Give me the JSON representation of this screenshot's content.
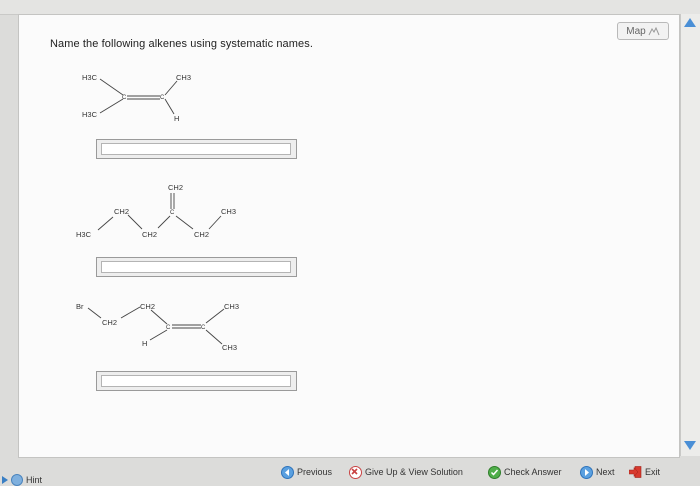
{
  "question": {
    "text": "Name the following alkenes using systematic names."
  },
  "map_button": {
    "label": "Map"
  },
  "molecules": [
    {
      "labels": {
        "ch3_top_left": "H3C",
        "ch3_top_right": "CH3",
        "ch3_bottom_left": "H3C",
        "h_right": "H",
        "c1": "C",
        "c2": "C"
      }
    },
    {
      "labels": {
        "h3c": "H3C",
        "ch2_a": "CH2",
        "ch2_b": "CH2",
        "ch2_top": "CH2",
        "c": "C",
        "ch2_c": "CH2",
        "ch3": "CH3"
      }
    },
    {
      "labels": {
        "br": "Br",
        "ch2_a": "CH2",
        "ch2_b": "CH2",
        "h": "H",
        "c1": "C",
        "c2": "C",
        "ch3_top": "CH3",
        "ch3_bottom": "CH3"
      }
    }
  ],
  "answers": [
    {
      "value": ""
    },
    {
      "value": ""
    },
    {
      "value": ""
    }
  ],
  "toolbar": {
    "previous": "Previous",
    "give_up": "Give Up & View Solution",
    "check": "Check Answer",
    "next": "Next",
    "exit": "Exit"
  },
  "hint": {
    "label": "Hint"
  },
  "colors": {
    "accent": "#4a8fd6",
    "give_up": "#c94343",
    "check": "#3f9e3a",
    "exit": "#d83a2e"
  }
}
